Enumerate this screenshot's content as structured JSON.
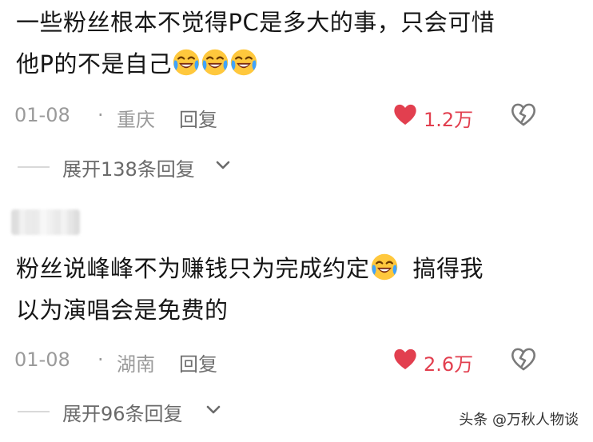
{
  "comments": [
    {
      "text_a": "一些粉丝根本不觉得PC是多大的事，只会可惜",
      "text_b": "他P的不是自己",
      "date": "01-08",
      "separator": "·",
      "location": "重庆",
      "reply_label": "回复",
      "likes": "1.2万",
      "expand_label": "展开138条回复"
    },
    {
      "text_a": "粉丝说峰峰不为赚钱只为完成约定",
      "text_b": "搞得我",
      "text_c": "以为演唱会是免费的",
      "date": "01-08",
      "separator": "·",
      "location": "湖南",
      "reply_label": "回复",
      "likes": "2.6万",
      "expand_label": "展开96条回复"
    }
  ],
  "icons": {
    "emoji": "laughing-crying-emoji-icon",
    "like": "heart-icon",
    "dislike": "broken-heart-icon",
    "expand": "chevron-down-icon"
  },
  "colors": {
    "like": "#e23f4f",
    "meta": "#9a9a9a",
    "text": "#161616"
  },
  "watermark": "头条 @万秋人物谈"
}
